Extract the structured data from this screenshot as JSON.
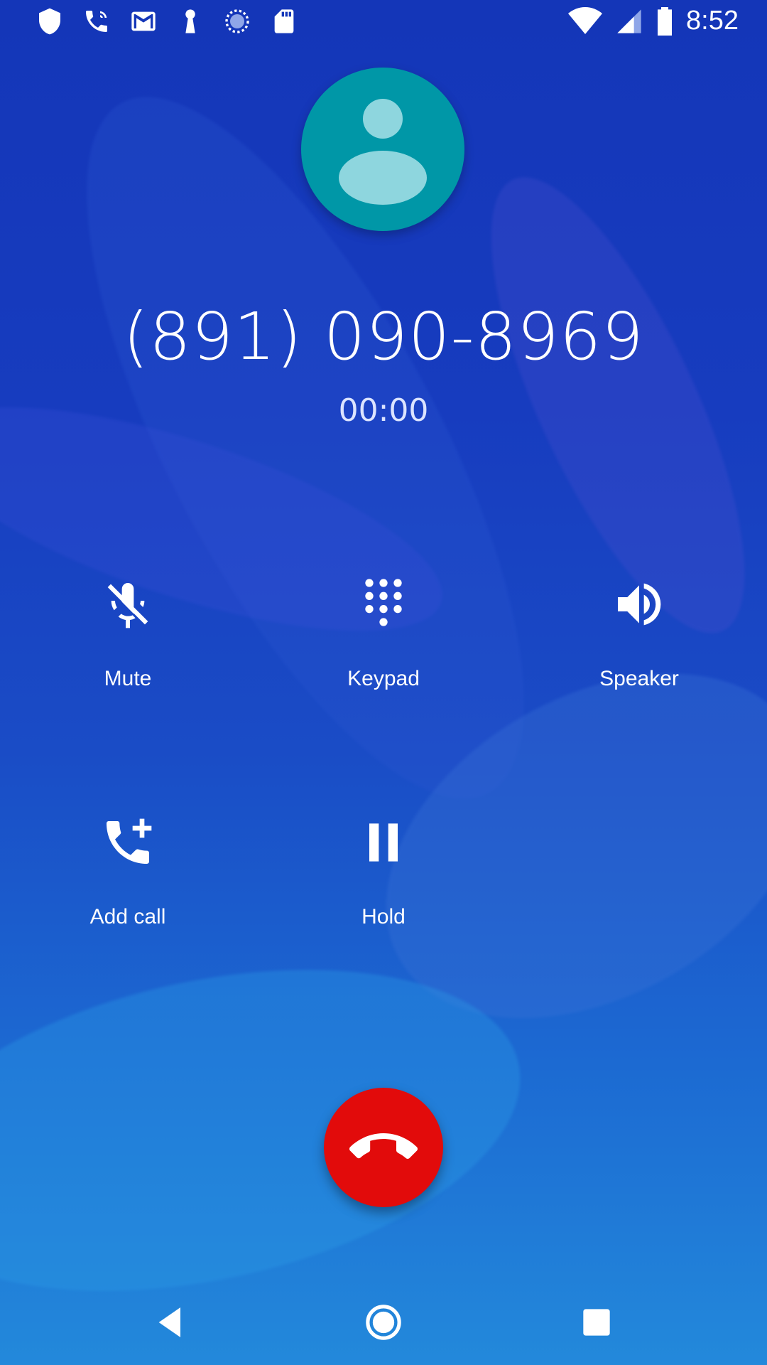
{
  "status_bar": {
    "time": "8:52",
    "icons_left": [
      "shield-icon",
      "wifi-call-icon",
      "gmail-icon",
      "keyhole-icon",
      "sync-circle-icon",
      "sd-card-icon"
    ],
    "icons_right": [
      "wifi-icon",
      "signal-icon",
      "battery-icon"
    ]
  },
  "call": {
    "phone_number": "(891) 090-8969",
    "duration": "00:00",
    "avatar_color": "#0097a7"
  },
  "actions": {
    "mute": "Mute",
    "keypad": "Keypad",
    "speaker": "Speaker",
    "add_call": "Add call",
    "hold": "Hold"
  },
  "end_call": {
    "color": "#e20b0b",
    "icon": "call-end-icon"
  },
  "nav": {
    "back": "back-icon",
    "home": "home-icon",
    "recents": "recents-icon"
  }
}
